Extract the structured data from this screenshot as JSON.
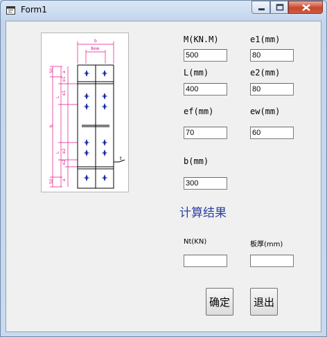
{
  "window": {
    "title": "Form1"
  },
  "fields": {
    "M": {
      "label": "M(KN.M)",
      "value": "500"
    },
    "e1": {
      "label": "e1(mm)",
      "value": "80"
    },
    "L": {
      "label": "L(mm)",
      "value": "400"
    },
    "e2": {
      "label": "e2(mm)",
      "value": "80"
    },
    "ef": {
      "label": "ef(mm)",
      "value": "70"
    },
    "ew": {
      "label": "ew(mm)",
      "value": "60"
    },
    "b": {
      "label": "b(mm)",
      "value": "300"
    }
  },
  "results": {
    "title": "计算结果",
    "Nt": {
      "label": "Nt(KN)",
      "value": ""
    },
    "thk": {
      "label": "板厚(mm)",
      "value": ""
    }
  },
  "buttons": {
    "ok": "确定",
    "exit": "退出"
  },
  "diagram": {
    "top_dims": [
      "b",
      "8ew"
    ],
    "side_dims_left": [
      "50",
      "L",
      "b",
      "L",
      "50"
    ],
    "side_dims_inner": [
      "a",
      "e1",
      "e1",
      "e2",
      "e2",
      "a"
    ],
    "plate_label": "t"
  },
  "colors": {
    "accent_text": "#2a3fa0",
    "dim_lines": "#e0148c",
    "bolts": "#1a2ea0"
  }
}
